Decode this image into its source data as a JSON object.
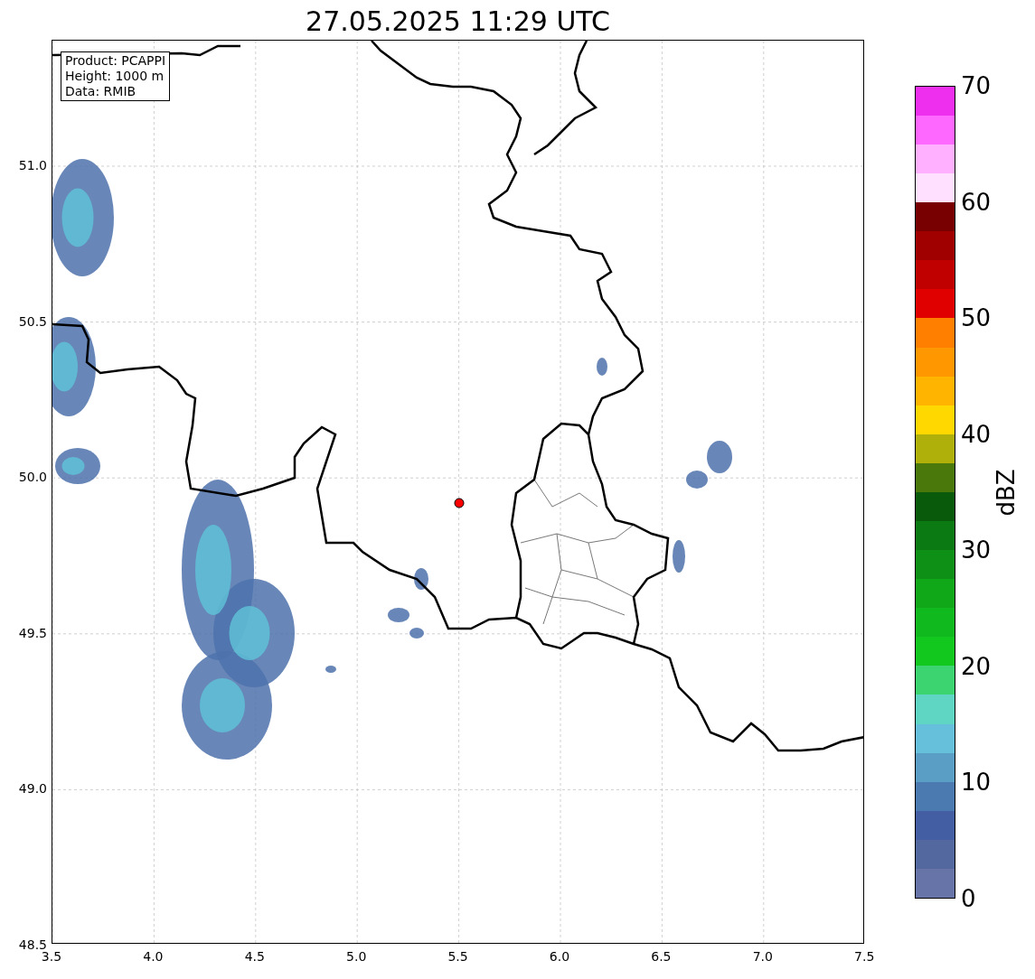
{
  "title": "27.05.2025 11:29 UTC",
  "info_box": {
    "lines": [
      "Product: PCAPPI",
      "Height: 1000 m",
      "Data: RMIB"
    ]
  },
  "map": {
    "xticks": [
      "3.5",
      "4.0",
      "4.5",
      "5.0",
      "5.5",
      "6.0",
      "6.5",
      "7.0",
      "7.5"
    ],
    "yticks": [
      "51.0",
      "50.5",
      "50.0",
      "49.5",
      "49.0",
      "48.5"
    ]
  },
  "colorbar": {
    "label": "dBZ",
    "ticks": [
      "70",
      "60",
      "50",
      "40",
      "30",
      "20",
      "10",
      "0"
    ],
    "levels": [
      {
        "color": "#6674a8"
      },
      {
        "color": "#5468a0"
      },
      {
        "color": "#445ea4"
      },
      {
        "color": "#4a7ab0"
      },
      {
        "color": "#5a9ec6"
      },
      {
        "color": "#66c0dc"
      },
      {
        "color": "#5fd6c4"
      },
      {
        "color": "#3cd470"
      },
      {
        "color": "#12c81e"
      },
      {
        "color": "#10ba1e"
      },
      {
        "color": "#10a818"
      },
      {
        "color": "#0e9016"
      },
      {
        "color": "#0c7a12"
      },
      {
        "color": "#0a5a0c"
      },
      {
        "color": "#4a780a"
      },
      {
        "color": "#b0b00a"
      },
      {
        "color": "#ffd800"
      },
      {
        "color": "#ffb400"
      },
      {
        "color": "#ff9800"
      },
      {
        "color": "#ff8000"
      },
      {
        "color": "#e00000"
      },
      {
        "color": "#c00000"
      },
      {
        "color": "#a00000"
      },
      {
        "color": "#780000"
      },
      {
        "color": "#ffe0ff"
      },
      {
        "color": "#ffb0ff"
      },
      {
        "color": "#ff68ff"
      },
      {
        "color": "#ee30ee"
      }
    ]
  }
}
